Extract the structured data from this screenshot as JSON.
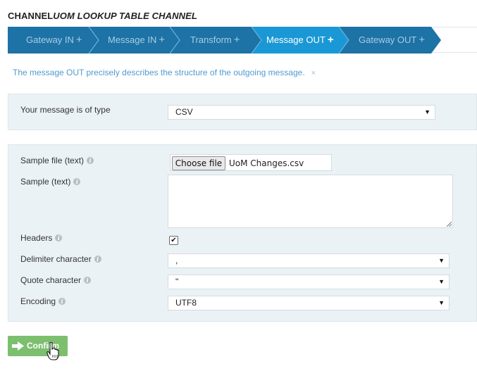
{
  "page": {
    "title_main": "CHANNEL",
    "title_italic": "UOM LOOKUP TABLE CHANNEL"
  },
  "wizard": {
    "steps": [
      {
        "label": "Gateway IN",
        "plus": "+",
        "active": false
      },
      {
        "label": "Message IN",
        "plus": "+",
        "active": false
      },
      {
        "label": "Transform",
        "plus": "+",
        "active": false
      },
      {
        "label": "Message OUT",
        "plus": "+",
        "active": true
      },
      {
        "label": "Gateway OUT",
        "plus": "+",
        "active": false
      }
    ],
    "colors": {
      "step": "#1d72a6",
      "active": "#1a98d5",
      "divider": "#6bb3de"
    }
  },
  "info": {
    "text": "The message OUT precisely describes the structure of the outgoing message.",
    "close": "×"
  },
  "type_panel": {
    "label": "Your message is of type",
    "value": "CSV",
    "caret": "▼"
  },
  "settings": {
    "sample_file": {
      "label": "Sample file (text)",
      "button": "Choose file",
      "file_name": "UoM Changes.csv"
    },
    "sample_text": {
      "label": "Sample (text)",
      "value": ""
    },
    "headers": {
      "label": "Headers",
      "checked": true,
      "mark": "✔"
    },
    "delimiter": {
      "label": "Delimiter character",
      "value": ",",
      "caret": "▼"
    },
    "quote": {
      "label": "Quote character",
      "value": "\"",
      "caret": "▼"
    },
    "encoding": {
      "label": "Encoding",
      "value": "UTF8",
      "caret": "▼"
    },
    "info_icon": "i"
  },
  "confirm": {
    "label": "Confirm",
    "color": "#7cbf6f"
  }
}
